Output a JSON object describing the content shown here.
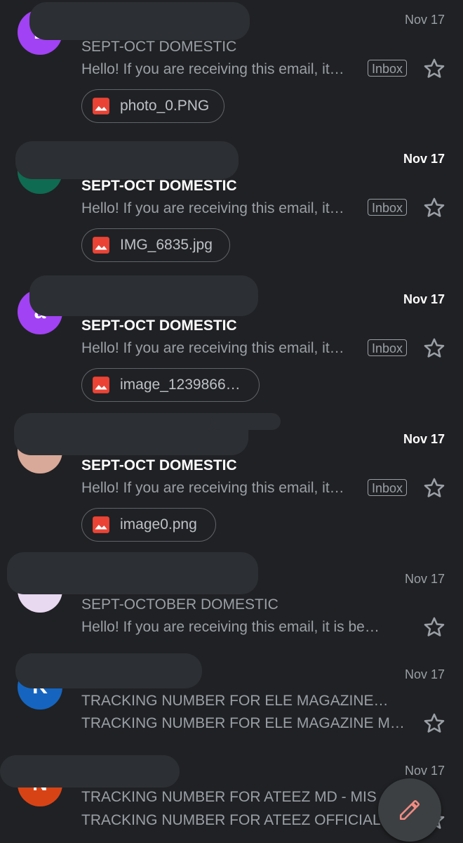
{
  "emails": [
    {
      "date": "Nov 17",
      "subject": "SEPT-OCT DOMESTIC",
      "snippet": "Hello! If you are receiving this email, it…",
      "label": "Inbox",
      "attachment": "photo_0.PNG",
      "avatar_initial": "L",
      "avatar_color": "#a142f4",
      "unread": false
    },
    {
      "date": "Nov 17",
      "subject": "SEPT-OCT DOMESTIC",
      "snippet": "Hello! If you are receiving this email, it…",
      "label": "Inbox",
      "attachment": "IMG_6835.jpg",
      "avatar_initial": "",
      "avatar_color": "#0f6b52",
      "unread": true
    },
    {
      "date": "Nov 17",
      "subject": "SEPT-OCT DOMESTIC",
      "snippet": "Hello! If you are receiving this email, it…",
      "label": "Inbox",
      "attachment": "image_1239866…",
      "avatar_initial": "a",
      "avatar_color": "#a142f4",
      "unread": true
    },
    {
      "date": "Nov 17",
      "subject": "SEPT-OCT DOMESTIC",
      "snippet": "Hello! If you are receiving this email, it…",
      "label": "Inbox",
      "attachment": "image0.png",
      "avatar_initial": "",
      "avatar_color": "#d8a898",
      "unread": true
    },
    {
      "date": "Nov 17",
      "subject": "SEPT-OCTOBER DOMESTIC",
      "snippet": "Hello! If you are receiving this email, it is be…",
      "label": "",
      "attachment": "",
      "avatar_initial": "",
      "avatar_color": "#e8d8f0",
      "unread": false
    },
    {
      "date": "Nov 17",
      "subject": "TRACKING NUMBER FOR ELE  MAGAZINE…",
      "snippet": "TRACKING NUMBER FOR ELE MAGAZINE M…",
      "label": "",
      "attachment": "",
      "avatar_initial": "K",
      "avatar_color": "#1565c0",
      "unread": false
    },
    {
      "date": "Nov 17",
      "subject": "TRACKING NUMBER FOR ATEEZ MD - MIS",
      "snippet": "TRACKING NUMBER FOR ATEEZ OFFICIAL",
      "label": "",
      "attachment": "",
      "avatar_initial": "N",
      "avatar_color": "#d84315",
      "unread": false
    }
  ],
  "icons": {
    "star": "star-outline-icon",
    "attachment": "image-icon",
    "compose": "pencil-icon"
  },
  "colors": {
    "background": "#202124",
    "unread_text": "#ffffff",
    "read_text": "#9aa0a6",
    "attachment_icon": "#ea4335",
    "compose_icon": "#f28b82"
  }
}
